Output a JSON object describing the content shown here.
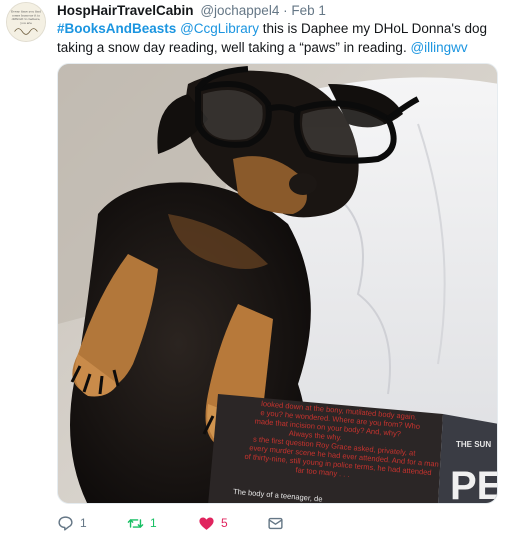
{
  "author": {
    "name": "HospHairTravelCabin",
    "handle": "@jochappel4",
    "date": "Feb 1",
    "avatar_text": "Every time you find some humour it is difficult to believe, you are"
  },
  "tweet": {
    "hashtag": "#BooksAndBeasts",
    "mention_library": "@CcgLibrary",
    "text_1": " this is Daphee my DHoL Donna's dog taking a snow day reading, well taking a “paws” in reading.  ",
    "mention_user": "@illingwv"
  },
  "book": {
    "line_1": "looked down at the bony, mutilated body again.",
    "line_2": "e you? he wondered. Where are you from? Who",
    "line_3": "made that incision on your body? And, why?",
    "line_4": "Always the why.",
    "line_5": "s the first question Roy Grace asked, privately, at",
    "line_6": "every murder scene he had ever attended. And for a man",
    "line_7": "of thirty-nine, still young in police terms, he had attended",
    "line_8": "far too many . . .",
    "line_9": "The body of a teenager, de",
    "spine_top": "THE SUN",
    "spine_big": "PE"
  },
  "actions": {
    "reply_count": "1",
    "retweet_count": "1",
    "like_count": "5"
  },
  "colors": {
    "link": "#1b95e0",
    "retweet": "#17bf63",
    "like": "#e0245e",
    "muted": "#657786"
  }
}
